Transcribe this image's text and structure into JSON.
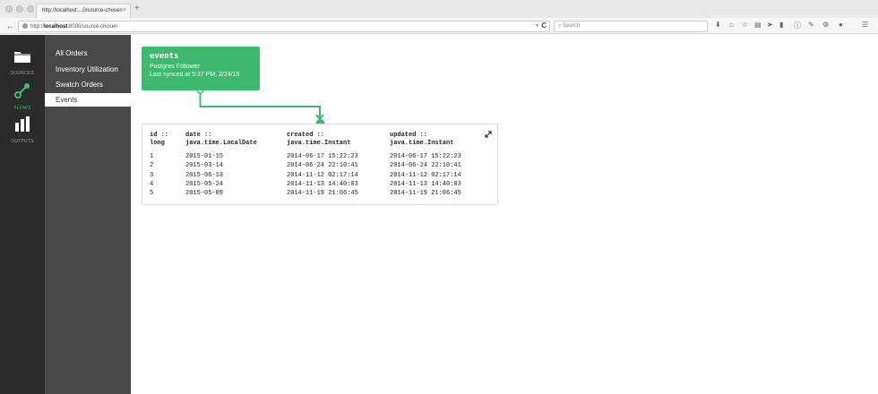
{
  "browser": {
    "tab_title": "http://localhost:...0/source-chosen",
    "tab_close": "×",
    "new_tab": "+",
    "back": "←",
    "url_prefix": "http://",
    "url_host": "localhost",
    "url_rest": ":8000/source-chosen",
    "url_dropdown": "▾",
    "reload": "C",
    "search_placeholder": "Search",
    "toolbar_icons": [
      "download-icon",
      "home-icon",
      "bookmark-star-icon",
      "reading-list-icon",
      "send-icon",
      "pocket-icon",
      "info-icon",
      "tools-icon",
      "addon-icon",
      "menu-icon"
    ]
  },
  "leftnav": {
    "items": [
      {
        "label": "SOURCES",
        "icon": "folder-icon"
      },
      {
        "label": "FLOWS",
        "icon": "flows-link-icon"
      },
      {
        "label": "OUTPUTS",
        "icon": "bar-chart-icon"
      }
    ],
    "active_index": 1
  },
  "subnav": {
    "items": [
      {
        "label": "All Orders"
      },
      {
        "label": "Inventory Utilization"
      },
      {
        "label": "Swatch Orders"
      },
      {
        "label": "Events"
      }
    ],
    "active_index": 3
  },
  "source_card": {
    "title": "events",
    "subtitle": "Postgres Follower",
    "synced": "Last synced at 5:37 PM, 2/24/15"
  },
  "table": {
    "columns": [
      {
        "name": "id ::",
        "type": "long"
      },
      {
        "name": "date ::",
        "type": "java.time.LocalDate"
      },
      {
        "name": "created ::",
        "type": "java.time.Instant"
      },
      {
        "name": "updated ::",
        "type": "java.time.Instant"
      }
    ],
    "rows": [
      [
        "1",
        "2015-01-15",
        "2014-06-17 15:22:23",
        "2014-06-17 15:22:23"
      ],
      [
        "2",
        "2015-03-14",
        "2014-06-24 22:10:41",
        "2014-06-24 22:10:41"
      ],
      [
        "3",
        "2015-06-13",
        "2014-11-12 02:17:14",
        "2014-11-12 02:17:14"
      ],
      [
        "4",
        "2015-05-24",
        "2014-11-13 14:40:03",
        "2014-11-13 14:40:03"
      ],
      [
        "5",
        "2015-05-09",
        "2014-11-19 21:06:45",
        "2014-11-19 21:06:45"
      ]
    ]
  },
  "colors": {
    "accent": "#3dba6d",
    "leftnav_bg": "#2b2b2b",
    "subnav_bg": "#484848"
  }
}
